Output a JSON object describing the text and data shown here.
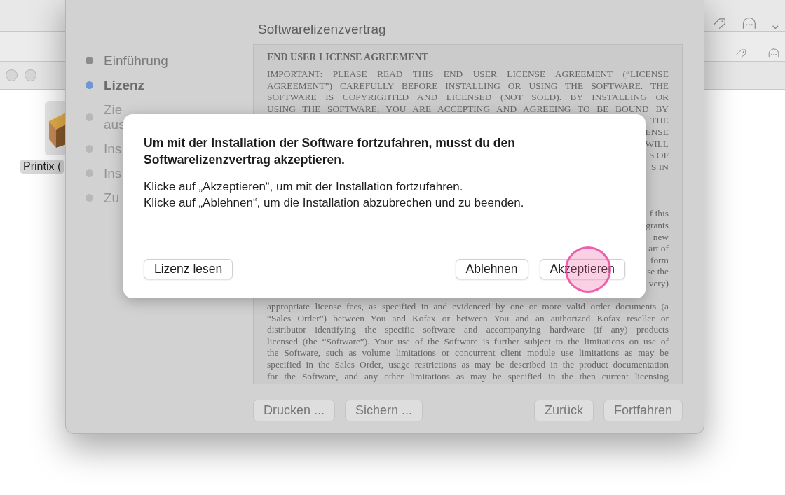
{
  "background_window_left": {
    "file_label": "Printix ("
  },
  "installer": {
    "heading": "Softwarelizenzvertrag",
    "steps": [
      {
        "label": "Einführung",
        "selected": false,
        "completed": true
      },
      {
        "label": "Lizenz",
        "selected": true,
        "completed": false
      },
      {
        "label": "Zie aus",
        "selected": false,
        "completed": false
      },
      {
        "label": "Ins",
        "selected": false,
        "completed": false
      },
      {
        "label": "Ins",
        "selected": false,
        "completed": false
      },
      {
        "label": "Zu",
        "selected": false,
        "completed": false
      }
    ],
    "license": {
      "title": "END USER LICENSE AGREEMENT",
      "paragraphs": [
        [
          {
            "kind": "full",
            "text": "IMPORTANT: PLEASE READ THIS END USER LICENSE AGREEMENT (“LICENSE"
          },
          {
            "kind": "full",
            "text": "AGREEMENT”) CAREFULLY BEFORE INSTALLING OR USING THE SOFTWARE. THE"
          },
          {
            "kind": "full",
            "text": "SOFTWARE IS COPYRIGHTED AND LICENSED (NOT SOLD). BY INSTALLING OR"
          },
          {
            "kind": "full",
            "text": "USING THE SOFTWARE, YOU ARE ACCEPTING AND AGREEING TO BE BOUND BY"
          },
          {
            "kind": "fragment",
            "text": "THE"
          },
          {
            "kind": "fragment",
            "text": "ENSE"
          },
          {
            "kind": "fragment",
            "text": "WILL"
          },
          {
            "kind": "fragment",
            "text": "S OF"
          },
          {
            "kind": "fragment",
            "text": "S IN"
          }
        ],
        [
          {
            "kind": "fragment",
            "text": "f this"
          },
          {
            "kind": "fragment",
            "text": "grants"
          },
          {
            "kind": "fragment",
            "text": "new"
          },
          {
            "kind": "fragment",
            "text": "art of"
          },
          {
            "kind": "fragment",
            "text": "form"
          },
          {
            "kind": "fragment",
            "text": "se the"
          },
          {
            "kind": "fragment",
            "text": "very)"
          },
          {
            "kind": "full",
            "text": "appropriate license fees, as specified in and evidenced by one or more valid order documents (a"
          },
          {
            "kind": "full",
            "text": "“Sales Order”) between You and Kofax or between You and an authorized Kofax reseller or"
          },
          {
            "kind": "full",
            "text": "distributor identifying the specific software and accompanying hardware (if any) products"
          },
          {
            "kind": "full",
            "text": "licensed (the “Software”). Your use of the Software is further  subject to the limitations on use of"
          },
          {
            "kind": "full",
            "text": "the Software, such as volume limitations or concurrent client module use limitations as may be"
          },
          {
            "kind": "full",
            "text": "specified in the Sales Order, usage restrictions as may be described in the product documentation"
          },
          {
            "kind": "full",
            "text": "for the Software, and any other limitations as may be specified in the then current licensing"
          }
        ]
      ]
    },
    "buttons_left": [
      "Drucken ...",
      "Sichern ..."
    ],
    "buttons_right": [
      "Zurück",
      "Fortfahren"
    ]
  },
  "dialog": {
    "title": "Um mit der Installation der Software fortzufahren, musst du den Softwarelizenzvertrag akzeptieren.",
    "message": [
      "Klicke auf „Akzeptieren“, um mit der Installation fortzufahren.",
      "Klicke auf „Ablehnen“, um die Installation abzubrechen und zu beenden."
    ],
    "button_left": "Lizenz lesen",
    "buttons_right": [
      {
        "label": "Ablehnen",
        "clicked": false
      },
      {
        "label": "Akzeptieren",
        "clicked": true
      }
    ]
  }
}
